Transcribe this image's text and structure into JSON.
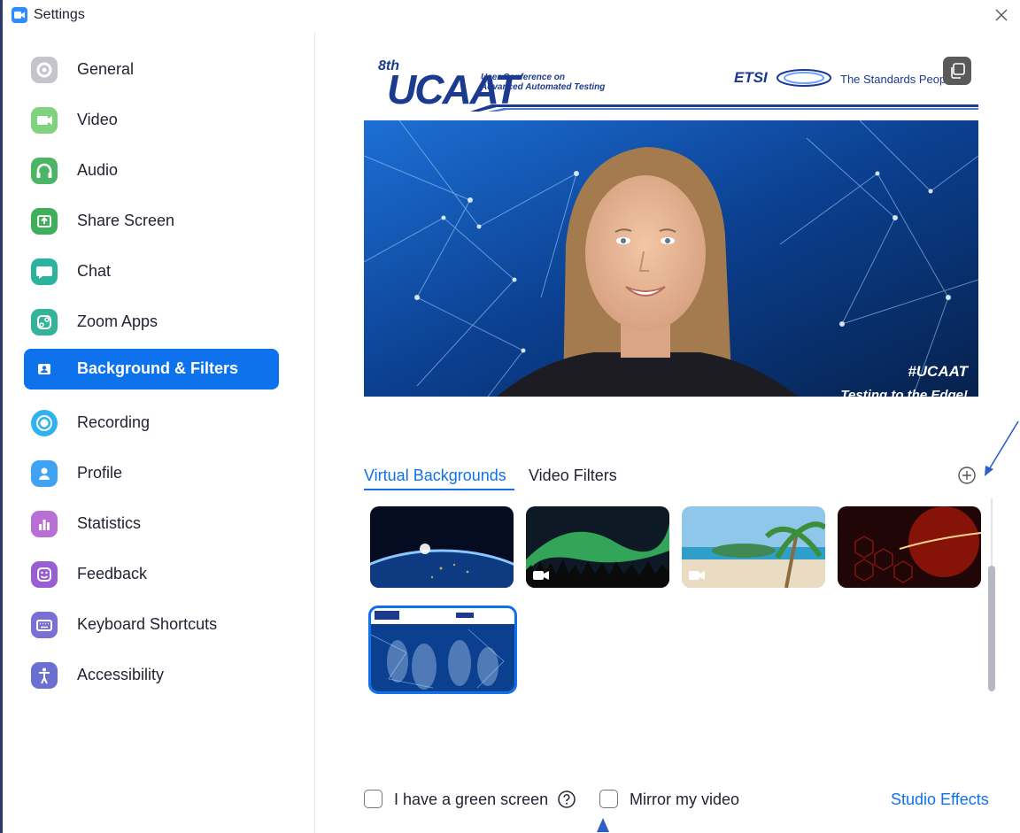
{
  "window": {
    "title": "Settings"
  },
  "sidebar": {
    "items": [
      {
        "label": "General",
        "icon": "gear-icon",
        "color": "#c4c4cc"
      },
      {
        "label": "Video",
        "icon": "video-camera-icon",
        "color": "#7fd37f"
      },
      {
        "label": "Audio",
        "icon": "headphones-icon",
        "color": "#4cb565"
      },
      {
        "label": "Share Screen",
        "icon": "share-screen-icon",
        "color": "#3fb05a"
      },
      {
        "label": "Chat",
        "icon": "chat-bubble-icon",
        "color": "#2bb3a0"
      },
      {
        "label": "Zoom Apps",
        "icon": "apps-icon",
        "color": "#35b39a"
      },
      {
        "label": "Background & Filters",
        "icon": "person-card-icon",
        "color": "#0e72ed",
        "active": true
      },
      {
        "label": "Recording",
        "icon": "record-icon",
        "color": "#2fb2f2"
      },
      {
        "label": "Profile",
        "icon": "person-icon",
        "color": "#3fa2f3"
      },
      {
        "label": "Statistics",
        "icon": "bar-chart-icon",
        "color": "#b76fd6"
      },
      {
        "label": "Feedback",
        "icon": "smiley-icon",
        "color": "#9a5ed4"
      },
      {
        "label": "Keyboard Shortcuts",
        "icon": "keyboard-icon",
        "color": "#7b6fd6"
      },
      {
        "label": "Accessibility",
        "icon": "accessibility-icon",
        "color": "#6a6fd1"
      }
    ]
  },
  "preview": {
    "banner_number": "8th",
    "banner_brand": "UCAAT",
    "banner_subtitle_1": "User Conference on",
    "banner_subtitle_2": "Advanced Automated Testing",
    "etsi_logo": "ETSI",
    "etsi_tagline": "The Standards People",
    "hashtag": "#UCAAT",
    "tagline": "Testing to the Edge!"
  },
  "tabs": {
    "virtual_backgrounds": "Virtual Backgrounds",
    "video_filters": "Video Filters",
    "active": "virtual_backgrounds"
  },
  "thumbnails": [
    {
      "name": "Earth from space",
      "has_video": false
    },
    {
      "name": "Aurora",
      "has_video": true
    },
    {
      "name": "Beach with palm tree",
      "has_video": true
    },
    {
      "name": "Red hexagons",
      "has_video": false
    },
    {
      "name": "UCAAT conference",
      "has_video": false,
      "selected": true
    }
  ],
  "options": {
    "green_screen_label": "I have a green screen",
    "mirror_label": "Mirror my video",
    "green_screen_checked": false,
    "mirror_checked": false,
    "studio_effects_label": "Studio Effects"
  },
  "colors": {
    "accent": "#0e72ed",
    "annotation_arrow": "#2e5ec8"
  }
}
